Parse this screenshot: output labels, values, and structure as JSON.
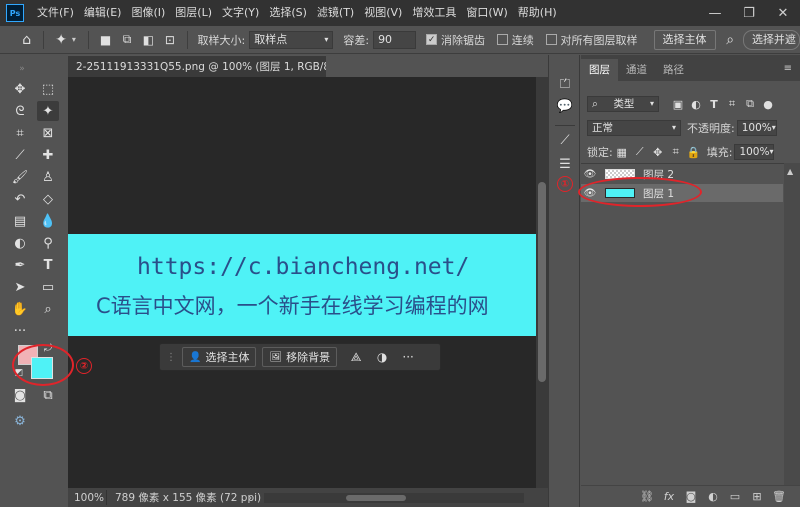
{
  "app": {
    "logo": "Ps"
  },
  "menu": [
    "文件(F)",
    "编辑(E)",
    "图像(I)",
    "图层(L)",
    "文字(Y)",
    "选择(S)",
    "滤镜(T)",
    "视图(V)",
    "增效工具",
    "窗口(W)",
    "帮助(H)"
  ],
  "window_controls": {
    "minimize": "—",
    "maximize": "❐",
    "close": "✕"
  },
  "options": {
    "sample_size_label": "取样大小:",
    "sample_size_value": "取样点",
    "tolerance_label": "容差:",
    "tolerance_value": "90",
    "antialias_label": "消除锯齿",
    "antialias_checked": true,
    "contiguous_label": "连续",
    "contiguous_checked": false,
    "all_layers_label": "对所有图层取样",
    "all_layers_checked": false,
    "select_subject": "选择主体",
    "select_and_mask": "选择并遮"
  },
  "document": {
    "tab_title": "2-25111913331Q55.png @ 100% (图层 1, RGB/8#) *",
    "tab_close": "×",
    "image_url_text": "https://c.biancheng.net/",
    "image_cn_text": "C语言中文网，一个新手在线学习编程的网"
  },
  "context_bar": {
    "select_subject": "选择主体",
    "remove_bg": "移除背景",
    "more": "···"
  },
  "status": {
    "zoom": "100%",
    "doc_info": "789 像素 x 155 像素 (72 ppi)",
    "arrow": "›"
  },
  "layers_panel": {
    "tabs": [
      "图层",
      "通道",
      "路径"
    ],
    "filter_kind": "类型",
    "blend_mode": "正常",
    "opacity_label": "不透明度:",
    "opacity_value": "100%",
    "lock_label": "锁定:",
    "fill_label": "填充:",
    "fill_value": "100%",
    "layers": [
      {
        "name": "图层 2",
        "thumb": "transparent",
        "selected": false
      },
      {
        "name": "图层 1",
        "thumb": "cyan",
        "selected": true
      }
    ]
  },
  "annotations": {
    "num1": "①",
    "num2": "②"
  },
  "colors": {
    "foreground": "#f1b2b6",
    "background": "#4ff2f6",
    "accent_red": "#e0242a"
  }
}
